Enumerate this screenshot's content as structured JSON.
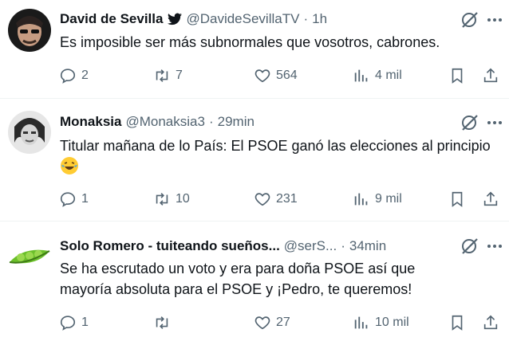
{
  "tweets": [
    {
      "name": "David de Sevilla",
      "handle": "@DavideSevillaTV",
      "dot": "·",
      "time": "1h",
      "text": "Es imposible ser más subnormales que vosotros, cabrones.",
      "replies": "2",
      "retweets": "7",
      "likes": "564",
      "views": "4 mil"
    },
    {
      "name": "Monaksia",
      "handle": "@Monaksia3",
      "dot": "·",
      "time": "29min",
      "text": "Titular mañana de lo País: El PSOE ganó las elecciones al principio",
      "replies": "1",
      "retweets": "10",
      "likes": "231",
      "views": "9 mil"
    },
    {
      "name": "Solo Romero - tuiteando sueños...",
      "handle": "@serS...",
      "dot": "·",
      "time": "34min",
      "text_line1": "Se ha escrutado un voto y era para doña PSOE así que",
      "text_line2": "mayoría absoluta para el PSOE y ¡Pedro, te queremos!",
      "replies": "1",
      "retweets": "",
      "likes": "27",
      "views": "10 mil"
    }
  ],
  "icons": {
    "reply": "reply-icon",
    "retweet": "retweet-icon",
    "like": "heart-icon",
    "views": "views-icon",
    "bookmark": "bookmark-icon",
    "share": "share-icon",
    "grok": "grok-icon",
    "more": "more-icon"
  },
  "colors": {
    "text": "#0f1419",
    "muted": "#536471",
    "divider": "#eff3f4"
  }
}
